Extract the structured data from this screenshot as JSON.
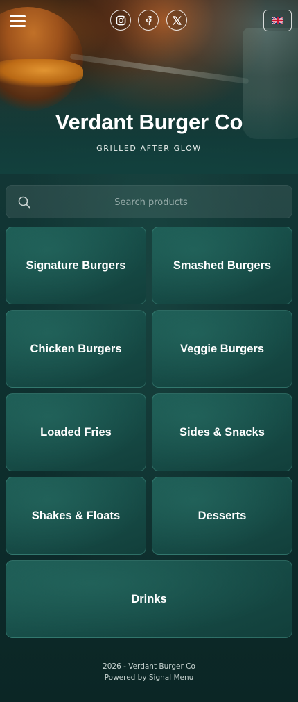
{
  "header": {
    "menu_icon": "hamburger-menu-icon",
    "social": [
      {
        "icon": "instagram-icon"
      },
      {
        "icon": "facebook-icon"
      },
      {
        "icon": "x-twitter-icon"
      }
    ],
    "language_icon": "uk-flag-icon"
  },
  "brand": {
    "name": "Verdant Burger Co",
    "tagline": "GRILLED AFTER GLOW"
  },
  "search": {
    "placeholder": "Search products",
    "icon": "search-icon"
  },
  "categories": [
    {
      "label": "Signature Burgers"
    },
    {
      "label": "Smashed Burgers"
    },
    {
      "label": "Chicken Burgers"
    },
    {
      "label": "Veggie Burgers"
    },
    {
      "label": "Loaded Fries"
    },
    {
      "label": "Sides & Snacks"
    },
    {
      "label": "Shakes & Floats"
    },
    {
      "label": "Desserts"
    },
    {
      "label": "Drinks"
    }
  ],
  "footer": {
    "copyright": "2026 - Verdant Burger Co",
    "powered_by": "Powered by Signal Menu"
  },
  "colors": {
    "background": "#0f3231",
    "card": "#1a544e",
    "card_border": "#3f8f82",
    "text": "#ffffff"
  }
}
